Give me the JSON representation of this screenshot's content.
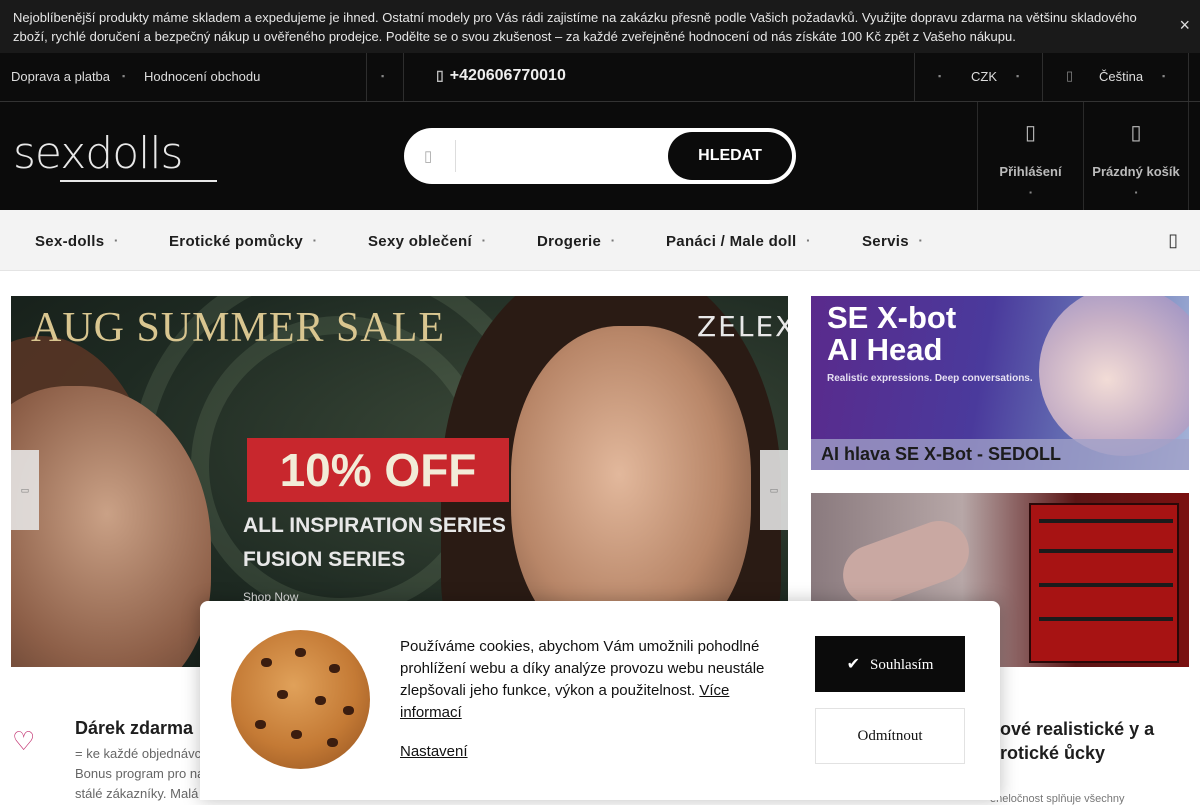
{
  "notice": {
    "text": "Nejoblíbenější produkty máme skladem a expedujeme je ihned. Ostatní modely pro Vás rádi zajistíme na zakázku přesně podle Vašich požadavků. Využijte dopravu zdarma na většinu skladového zboží, rychlé doručení a bezpečný nákup u ověřeného prodejce. Podělte se o svou zkušenost – za každé zveřejněné hodnocení od nás získáte 100 Kč zpět z Vašeho nákupu.",
    "close_icon": "×"
  },
  "topbar": {
    "links": [
      "Doprava a platba",
      "Hodnocení obchodu"
    ],
    "phone": "+420606770010",
    "currency": "CZK",
    "language": "Čeština"
  },
  "header": {
    "logo": "sexdolls",
    "search_button": "HLEDAT",
    "search_placeholder": "",
    "login": "Přihlášení",
    "cart": "Prázdný košík"
  },
  "nav": {
    "items": [
      "Sex-dolls",
      "Erotické pomůcky",
      "Sexy oblečení",
      "Drogerie",
      "Panáci / Male doll",
      "Servis"
    ]
  },
  "hero": {
    "title": "AUG SUMMER SALE",
    "brand": "ZELEX",
    "offer": "10% OFF",
    "line1": "ALL INSPIRATION SERIES",
    "line2": "FUSION SERIES",
    "shop": "Shop Now"
  },
  "banners": {
    "b1_title_1": "SE X-bot",
    "b1_title_2": "AI Head",
    "b1_sub": "Realistic expressions. Deep conversations.",
    "b1_caption": "AI hlava SE X-Bot - SEDOLL"
  },
  "features": {
    "f1_title": "Dárek zdarma",
    "f1_text": "= ke každé objednávce Bonus program pro naše stálé zákazníky. Malá",
    "f2_title": "kové realistické y a erotické ůcky",
    "f2_text": "eneločnost splňuje všechny"
  },
  "cookie": {
    "text": "Používáme cookies, abychom Vám umožnili pohodlné prohlížení webu a díky analýze provozu webu neustále zlepšovali jeho funkce, výkon a použitelnost.",
    "more": "Více informací",
    "settings": "Nastavení",
    "accept": "Souhlasím",
    "reject": "Odmítnout"
  },
  "colors": {
    "dark": "#0b0b0b",
    "accent_red": "#c8272d",
    "nav_bg": "#f3f3f3"
  }
}
